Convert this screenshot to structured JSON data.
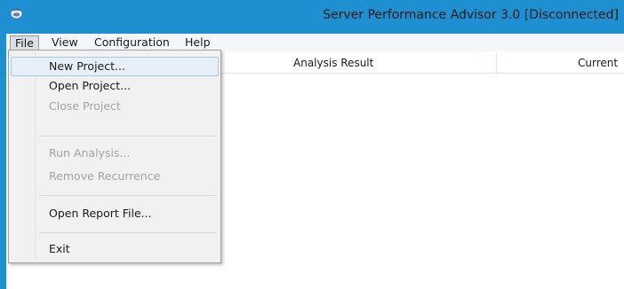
{
  "window": {
    "title": "Server Performance Advisor 3.0 [Disconnected]",
    "icon": "app-icon"
  },
  "menubar": {
    "items": [
      {
        "label": "File",
        "active": true
      },
      {
        "label": "View",
        "active": false
      },
      {
        "label": "Configuration",
        "active": false
      },
      {
        "label": "Help",
        "active": false
      }
    ]
  },
  "grid": {
    "columns": [
      "Analysis Result",
      "Current"
    ]
  },
  "file_menu": {
    "items": [
      {
        "label": "New Project...",
        "enabled": true,
        "highlighted": true
      },
      {
        "label": "Open Project...",
        "enabled": true
      },
      {
        "label": "Close Project",
        "enabled": false
      },
      {
        "label": "Run Analysis...",
        "enabled": false
      },
      {
        "label": "Remove Recurrence",
        "enabled": false
      },
      {
        "label": "Open Report File...",
        "enabled": true
      },
      {
        "label": "Exit",
        "enabled": true
      }
    ]
  },
  "colors": {
    "title_bar": "#1e8fd0",
    "menu_bar": "#f5f6f7",
    "dropdown_bg": "#f1f1f1",
    "highlight": "#e7f0f9",
    "disabled_text": "#a3a3a3"
  }
}
